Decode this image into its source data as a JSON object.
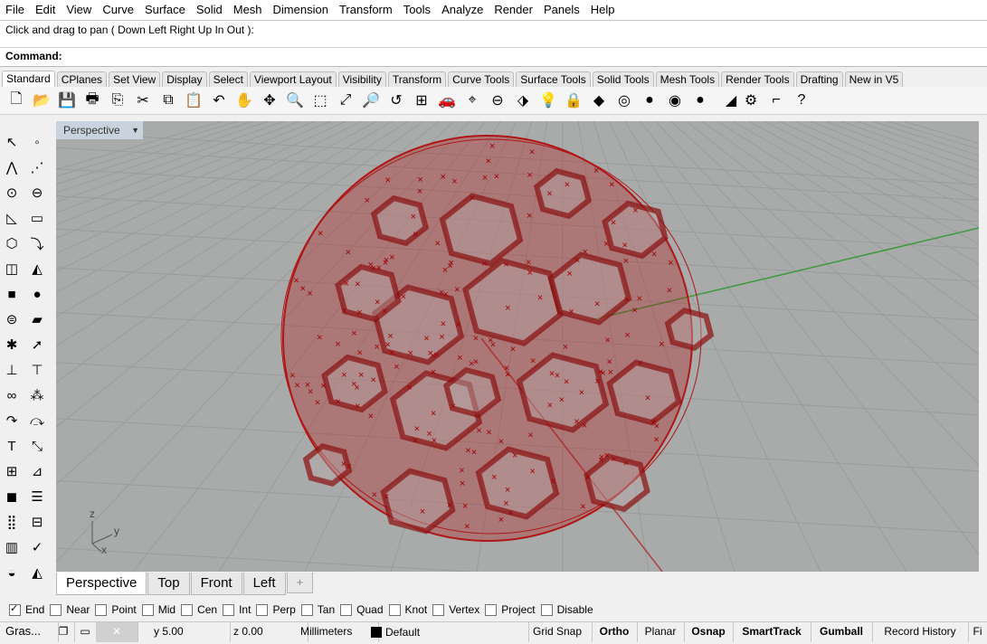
{
  "menu": [
    "File",
    "Edit",
    "View",
    "Curve",
    "Surface",
    "Solid",
    "Mesh",
    "Dimension",
    "Transform",
    "Tools",
    "Analyze",
    "Render",
    "Panels",
    "Help"
  ],
  "command_history": "Click and drag to pan ( Down  Left  Right  Up  In  Out ):",
  "command_label": "Command:",
  "toolbar_tabs": [
    "Standard",
    "CPlanes",
    "Set View",
    "Display",
    "Select",
    "Viewport Layout",
    "Visibility",
    "Transform",
    "Curve Tools",
    "Surface Tools",
    "Solid Tools",
    "Mesh Tools",
    "Render Tools",
    "Drafting",
    "New in V5"
  ],
  "viewport": {
    "name": "Perspective",
    "axis_z": "z",
    "axis_y": "y",
    "axis_x": "x"
  },
  "viewport_tabs": [
    "Perspective",
    "Top",
    "Front",
    "Left",
    "+"
  ],
  "osnaps": [
    {
      "label": "End",
      "checked": true
    },
    {
      "label": "Near",
      "checked": false
    },
    {
      "label": "Point",
      "checked": false
    },
    {
      "label": "Mid",
      "checked": false
    },
    {
      "label": "Cen",
      "checked": false
    },
    {
      "label": "Int",
      "checked": false
    },
    {
      "label": "Perp",
      "checked": false
    },
    {
      "label": "Tan",
      "checked": false
    },
    {
      "label": "Quad",
      "checked": false
    },
    {
      "label": "Knot",
      "checked": false
    },
    {
      "label": "Vertex",
      "checked": false
    },
    {
      "label": "Project",
      "checked": false
    },
    {
      "label": "Disable",
      "checked": false
    }
  ],
  "status": {
    "window_label": "Gras...",
    "y": "y 5.00",
    "z": "z 0.00",
    "units": "Millimeters",
    "layer": "Default",
    "grid_snap": "Grid Snap",
    "ortho": "Ortho",
    "planar": "Planar",
    "osnap": "Osnap",
    "smarttrack": "SmartTrack",
    "gumball": "Gumball",
    "record_history": "Record History",
    "filter": "Fi"
  },
  "colors": {
    "object": "#b01616",
    "viewport_bg": "#a9abab",
    "grid": "#9a9c9c",
    "x_axis": "#b04040",
    "y_axis": "#3c9a3c"
  }
}
